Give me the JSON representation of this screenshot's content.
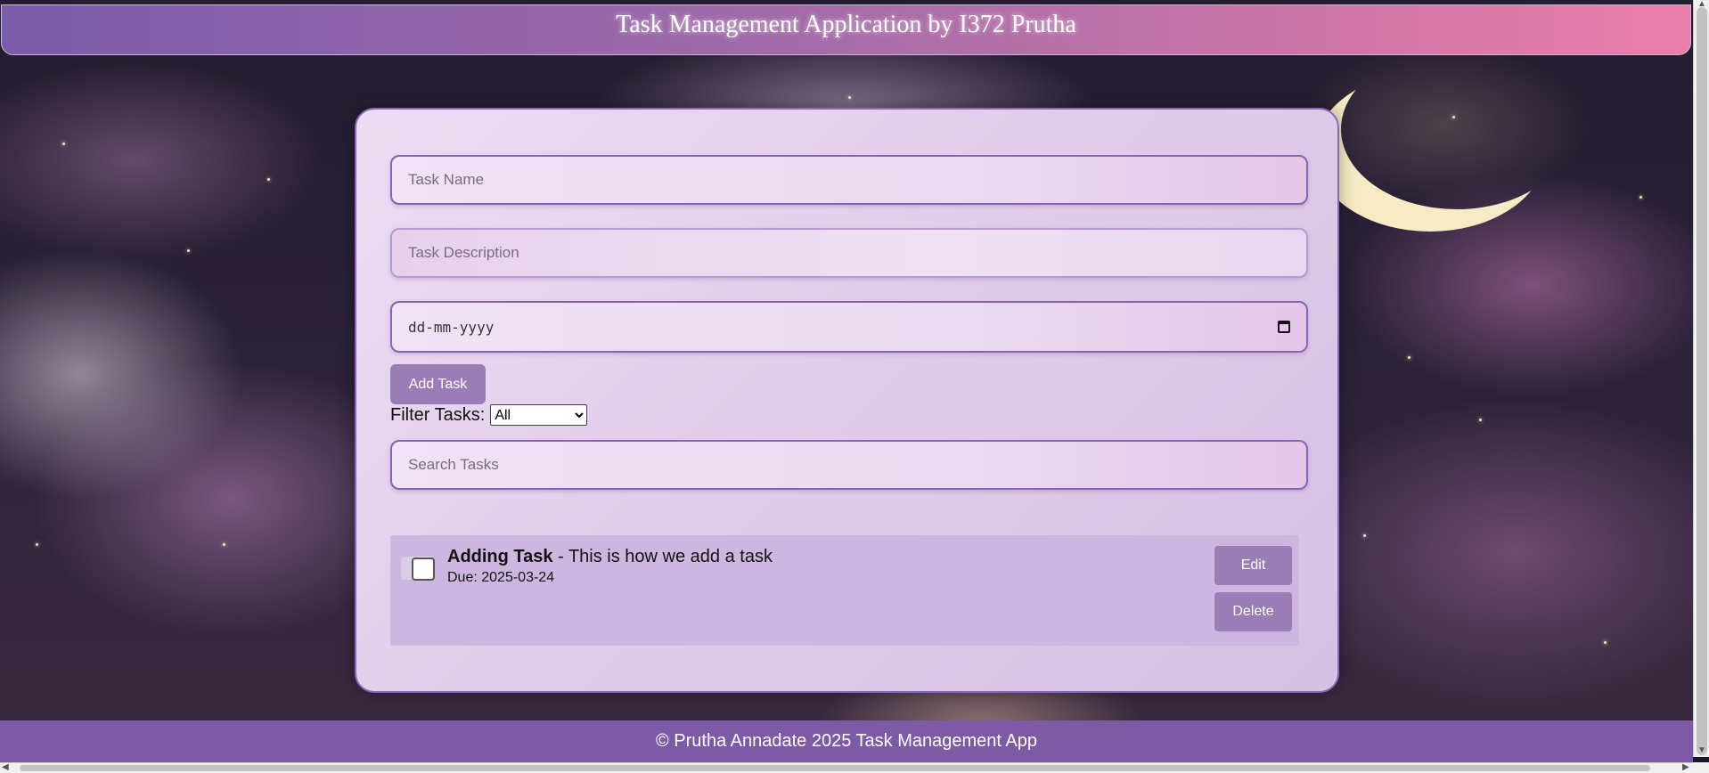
{
  "app": {
    "title": "Task Management Application by I372 Prutha"
  },
  "form": {
    "task_name_placeholder": "Task Name",
    "task_description_placeholder": "Task Description",
    "due_date_placeholder": "dd-mm-yyyy",
    "add_button_label": "Add Task",
    "filter_label": "Filter Tasks:",
    "filter_selected": "All",
    "search_placeholder": "Search Tasks"
  },
  "tasks": [
    {
      "name": "Adding Task",
      "description": " - This is how we add a task",
      "due": "Due: 2025-03-24",
      "completed": false,
      "edit_label": "Edit",
      "delete_label": "Delete"
    }
  ],
  "footer": {
    "text": "© Prutha Annadate 2025 Task Management App"
  },
  "icons": {
    "date_picker": "calendar-icon",
    "checkbox": "checkbox"
  },
  "colors": {
    "header_gradient_start": "#7b5cab",
    "header_gradient_end": "#ec7faa",
    "button": "#9a7cb6",
    "footer": "#7d5aa6",
    "card_border": "#8c67b8",
    "task_item_bg": "#cdb7e0"
  }
}
